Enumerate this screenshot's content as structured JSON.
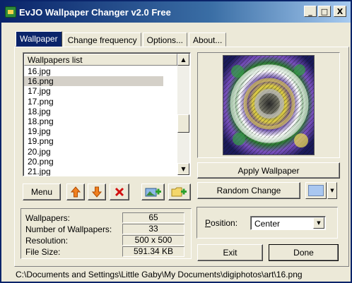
{
  "window": {
    "title": "EvJO Wallpaper Changer v2.0 Free",
    "controls": {
      "minimize": "_",
      "maximize": "□",
      "close": "X"
    }
  },
  "tabs": [
    {
      "label": "Wallpaper",
      "active": true
    },
    {
      "label": "Change frequency",
      "active": false
    },
    {
      "label": "Options...",
      "active": false
    },
    {
      "label": "About...",
      "active": false
    }
  ],
  "wallpaper_list": {
    "header": "Wallpapers list",
    "items": [
      "16.jpg",
      "16.png",
      "17.jpg",
      "17.png",
      "18.jpg",
      "18.png",
      "19.jpg",
      "19.png",
      "20.jpg",
      "20.png",
      "21.jpg"
    ],
    "selected_index": 1
  },
  "list_buttons": {
    "menu_label": "Menu",
    "move_up_icon": "orange-up-arrow-icon",
    "move_down_icon": "orange-down-arrow-icon",
    "delete_icon": "red-x-icon",
    "add_image_icon": "add-image-icon",
    "add_folder_icon": "add-folder-icon"
  },
  "info": {
    "rows": [
      {
        "label": "Wallpapers:",
        "value": "65"
      },
      {
        "label": "Number of Wallpapers:",
        "value": "33"
      },
      {
        "label": "Resolution:",
        "value": "500 x 500"
      },
      {
        "label": "File Size:",
        "value": "591.34 KB"
      }
    ]
  },
  "actions": {
    "apply_label": "Apply Wallpaper",
    "random_label": "Random Change",
    "exit_label": "Exit",
    "done_label": "Done"
  },
  "position": {
    "label": "Position:",
    "mnemonic": "P",
    "label_rest": "osition:",
    "value": "Center"
  },
  "background_color": "#a9c7f0",
  "status": {
    "path": "C:\\Documents and Settings\\Little Gaby\\My Documents\\digiphotos\\art\\16.png"
  },
  "colors": {
    "title_bar": "#0a246a",
    "face": "#ece9d8",
    "active_tab": "#0a246a"
  }
}
